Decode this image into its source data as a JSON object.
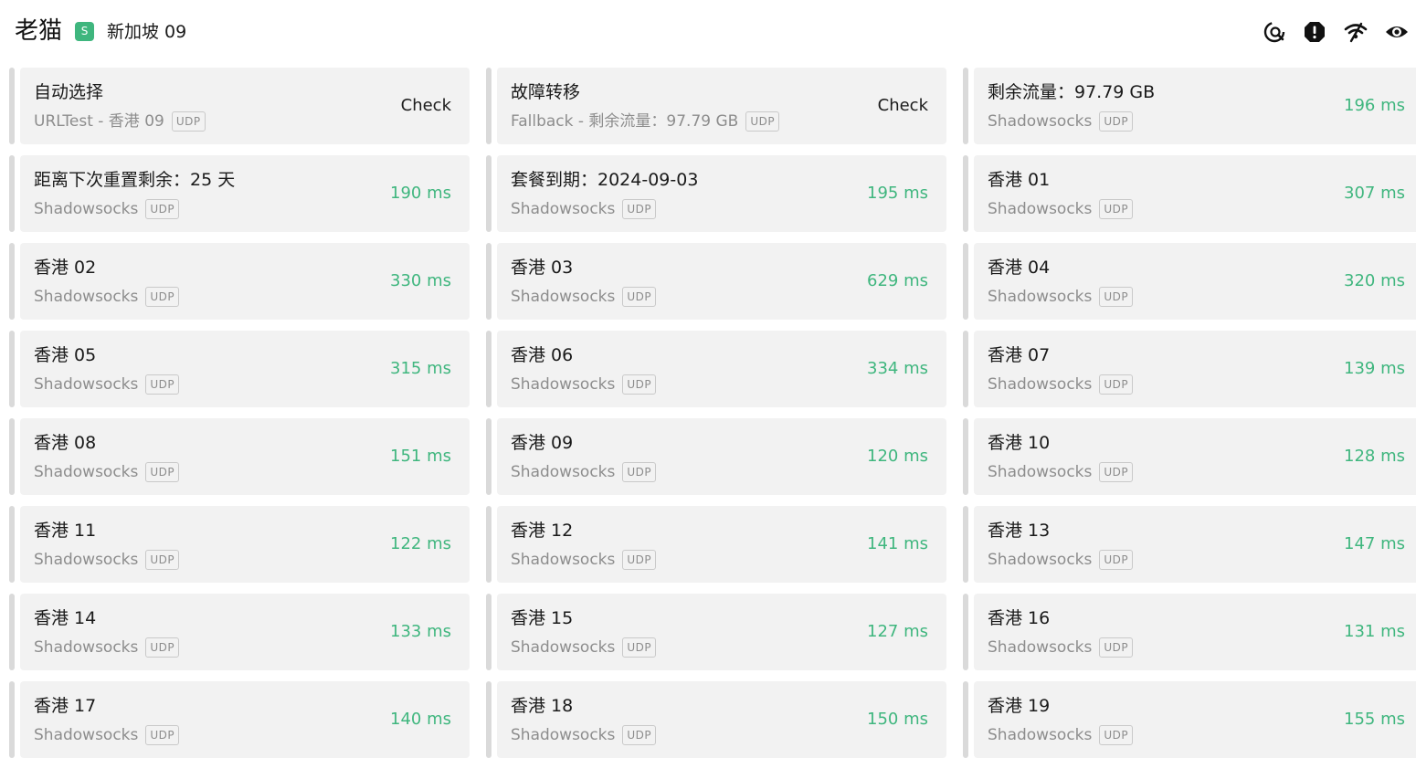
{
  "header": {
    "group_name": "老猫",
    "type_badge": "S",
    "current_node": "新加坡 09",
    "tools": [
      {
        "name": "search-icon"
      },
      {
        "name": "alert-icon"
      },
      {
        "name": "wifi-icon"
      },
      {
        "name": "eye-icon"
      }
    ]
  },
  "colors": {
    "accent": "#3fb67e",
    "card_bg": "#f2f2f2",
    "card_bar": "#dadada"
  },
  "proxies": [
    {
      "title": "自动选择",
      "type": "URLTest - 香港 09",
      "udp": "UDP",
      "right": "Check",
      "kind": "check"
    },
    {
      "title": "故障转移",
      "type": "Fallback - 剩余流量：97.79 GB",
      "udp": "UDP",
      "right": "Check",
      "kind": "check"
    },
    {
      "title": "剩余流量：97.79 GB",
      "type": "Shadowsocks",
      "udp": "UDP",
      "right": "196 ms",
      "kind": "latency"
    },
    {
      "title": "距离下次重置剩余：25 天",
      "type": "Shadowsocks",
      "udp": "UDP",
      "right": "190 ms",
      "kind": "latency"
    },
    {
      "title": "套餐到期：2024-09-03",
      "type": "Shadowsocks",
      "udp": "UDP",
      "right": "195 ms",
      "kind": "latency"
    },
    {
      "title": "香港 01",
      "type": "Shadowsocks",
      "udp": "UDP",
      "right": "307 ms",
      "kind": "latency"
    },
    {
      "title": "香港 02",
      "type": "Shadowsocks",
      "udp": "UDP",
      "right": "330 ms",
      "kind": "latency"
    },
    {
      "title": "香港 03",
      "type": "Shadowsocks",
      "udp": "UDP",
      "right": "629 ms",
      "kind": "latency"
    },
    {
      "title": "香港 04",
      "type": "Shadowsocks",
      "udp": "UDP",
      "right": "320 ms",
      "kind": "latency"
    },
    {
      "title": "香港 05",
      "type": "Shadowsocks",
      "udp": "UDP",
      "right": "315 ms",
      "kind": "latency"
    },
    {
      "title": "香港 06",
      "type": "Shadowsocks",
      "udp": "UDP",
      "right": "334 ms",
      "kind": "latency"
    },
    {
      "title": "香港 07",
      "type": "Shadowsocks",
      "udp": "UDP",
      "right": "139 ms",
      "kind": "latency"
    },
    {
      "title": "香港 08",
      "type": "Shadowsocks",
      "udp": "UDP",
      "right": "151 ms",
      "kind": "latency"
    },
    {
      "title": "香港 09",
      "type": "Shadowsocks",
      "udp": "UDP",
      "right": "120 ms",
      "kind": "latency"
    },
    {
      "title": "香港 10",
      "type": "Shadowsocks",
      "udp": "UDP",
      "right": "128 ms",
      "kind": "latency"
    },
    {
      "title": "香港 11",
      "type": "Shadowsocks",
      "udp": "UDP",
      "right": "122 ms",
      "kind": "latency"
    },
    {
      "title": "香港 12",
      "type": "Shadowsocks",
      "udp": "UDP",
      "right": "141 ms",
      "kind": "latency"
    },
    {
      "title": "香港 13",
      "type": "Shadowsocks",
      "udp": "UDP",
      "right": "147 ms",
      "kind": "latency"
    },
    {
      "title": "香港 14",
      "type": "Shadowsocks",
      "udp": "UDP",
      "right": "133 ms",
      "kind": "latency"
    },
    {
      "title": "香港 15",
      "type": "Shadowsocks",
      "udp": "UDP",
      "right": "127 ms",
      "kind": "latency"
    },
    {
      "title": "香港 16",
      "type": "Shadowsocks",
      "udp": "UDP",
      "right": "131 ms",
      "kind": "latency"
    },
    {
      "title": "香港 17",
      "type": "Shadowsocks",
      "udp": "UDP",
      "right": "140 ms",
      "kind": "latency"
    },
    {
      "title": "香港 18",
      "type": "Shadowsocks",
      "udp": "UDP",
      "right": "150 ms",
      "kind": "latency"
    },
    {
      "title": "香港 19",
      "type": "Shadowsocks",
      "udp": "UDP",
      "right": "155 ms",
      "kind": "latency"
    }
  ]
}
